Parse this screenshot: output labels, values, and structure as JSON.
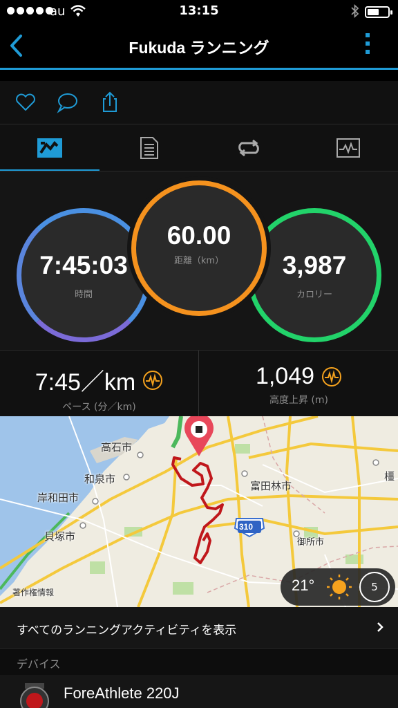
{
  "status_bar": {
    "carrier": "au",
    "time": "13:15"
  },
  "nav": {
    "title": "Fukuda ランニング",
    "back_icon": "chevron-left-icon",
    "more_icon": "more-vertical-icon"
  },
  "colors": {
    "accent": "#1f9bd6",
    "time_ring": "#4a90e2",
    "distance_ring": "#f5921e",
    "calorie_ring": "#22d36a",
    "route": "#c0171b",
    "pin": "#e8475a"
  },
  "stats": {
    "time": {
      "value": "7:45:03",
      "label": "時間"
    },
    "distance": {
      "value": "60.00",
      "label": "距離（km）"
    },
    "calories": {
      "value": "3,987",
      "label": "カロリー"
    }
  },
  "metrics": {
    "pace": {
      "value": "7:45／km",
      "label": "ペース (分／km)"
    },
    "elevation": {
      "value": "1,049",
      "label": "高度上昇 (m)"
    }
  },
  "map": {
    "labels": [
      "高石市",
      "和泉市",
      "岸和田市",
      "貝塚市",
      "富田林市",
      "御所市",
      "橿",
      "著作権情報"
    ],
    "road_badge": "310"
  },
  "weather": {
    "temp": "21°",
    "wind": "5"
  },
  "all_activities": "すべてのランニングアクティビティを表示",
  "section_devices": "デバイス",
  "device_name": "ForeAthlete 220J"
}
